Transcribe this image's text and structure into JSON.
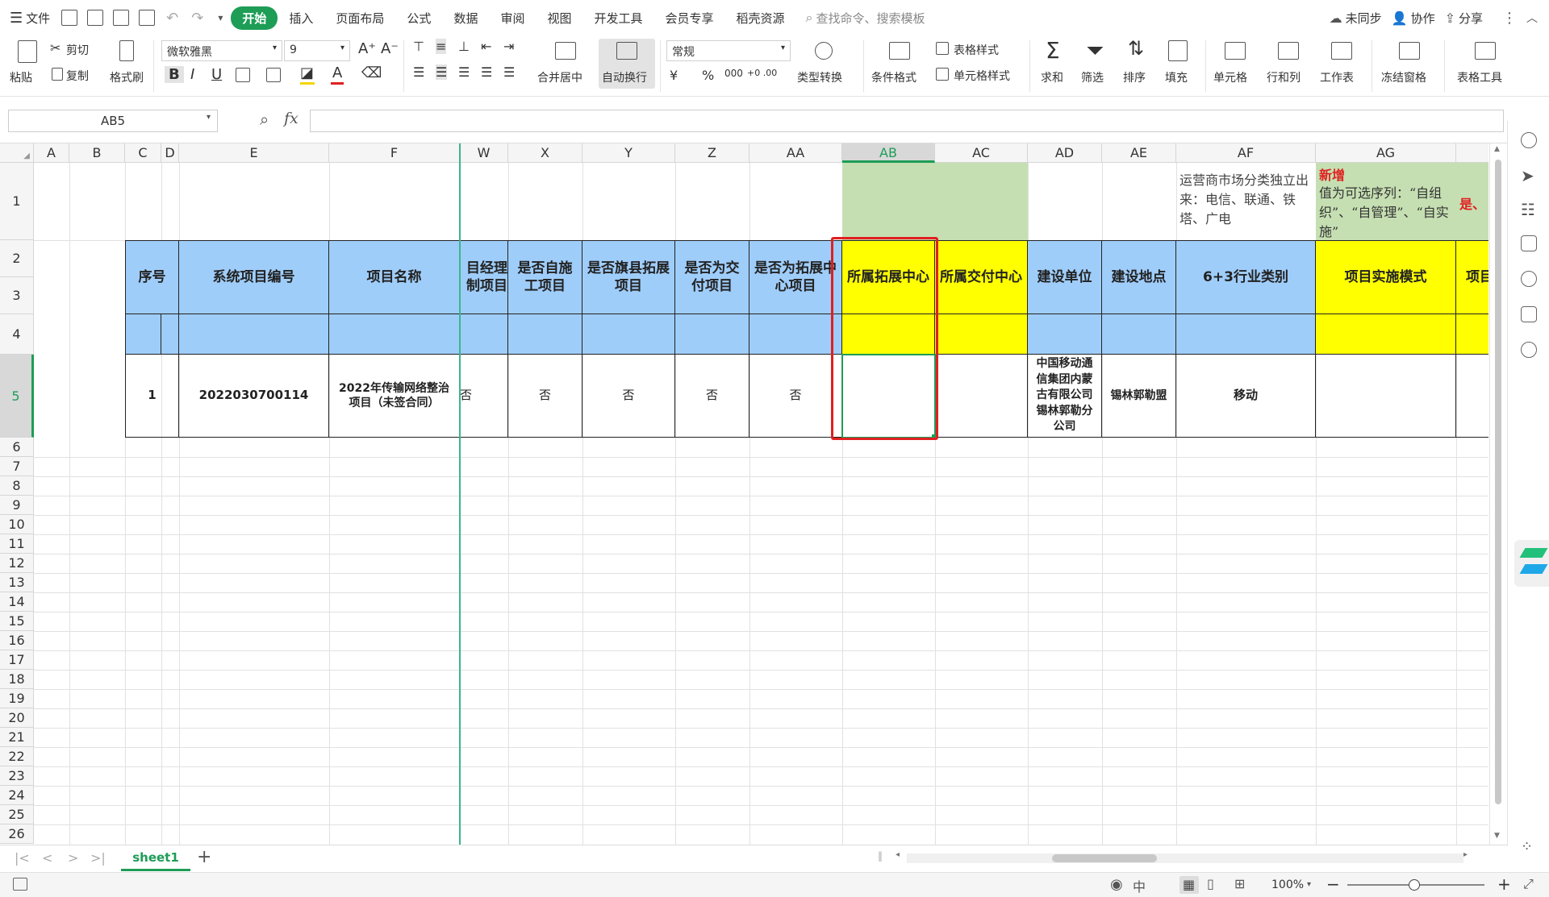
{
  "menubar": {
    "file_label": "文件",
    "tabs": [
      "开始",
      "插入",
      "页面布局",
      "公式",
      "数据",
      "审阅",
      "视图",
      "开发工具",
      "会员专享",
      "稻壳资源"
    ],
    "active_tab": "开始",
    "search_placeholder": "查找命令、搜索模板",
    "sync_label": "未同步",
    "collab_label": "协作",
    "share_label": "分享"
  },
  "ribbon": {
    "paste": "粘贴",
    "cut": "剪切",
    "copy": "复制",
    "format_painter": "格式刷",
    "font_name": "微软雅黑",
    "font_size": "9",
    "bold": "B",
    "italic": "I",
    "underline": "U",
    "font_color": "A",
    "merge_center": "合并居中",
    "wrap_text": "自动换行",
    "number_format": "常规",
    "currency": "¥",
    "percent": "%",
    "thousands": "000",
    "dec_inc": "+0 .00",
    "dec_dec": ".00 →0",
    "type_convert": "类型转换",
    "cond_format": "条件格式",
    "table_style": "表格样式",
    "cell_style": "单元格样式",
    "sum": "求和",
    "filter": "筛选",
    "sort": "排序",
    "fill": "填充",
    "cell": "单元格",
    "row_col": "行和列",
    "sheet": "工作表",
    "freeze": "冻结窗格",
    "table_tools": "表格工具"
  },
  "formula_bar": {
    "name_box": "AB5",
    "fx": "fx",
    "content": ""
  },
  "columns": [
    "A",
    "B",
    "C",
    "D",
    "E",
    "F",
    "W",
    "X",
    "Y",
    "Z",
    "AA",
    "AB",
    "AC",
    "AD",
    "AE",
    "AF",
    "AG"
  ],
  "rows": [
    "1",
    "2",
    "3",
    "4",
    "5",
    "6",
    "7",
    "8",
    "9",
    "10",
    "11",
    "12",
    "13",
    "14",
    "15",
    "16",
    "17",
    "18",
    "19",
    "20",
    "21",
    "22",
    "23",
    "24",
    "25",
    "26"
  ],
  "notes": {
    "af1": "运营商市场分类独立出来：电信、联通、铁塔、广电",
    "ag1_new": "新增",
    "ag1_text": "值为可选序列：“自组织”、“自管理”、“自实施”",
    "ah1": "是、"
  },
  "headers": {
    "seq": "序号",
    "sys_id": "系统项目编号",
    "proj_name": "项目名称",
    "w": "目经理\n制项目",
    "x": "是否自施\n工项目",
    "y": "是否旗县拓展\n项目",
    "z": "是否为交\n付项目",
    "aa": "是否为拓展中\n心项目",
    "ab": "所属拓展中心",
    "ac": "所属交付中心",
    "ad": "建设单位",
    "ae": "建设地点",
    "af": "6+3行业类别",
    "ag": "项目实施模式",
    "ah": "项目"
  },
  "row5": {
    "seq": "1",
    "sys_id": "2022030700114",
    "proj_name": "2022年传输网络整治\n项目（未签合同）",
    "w": "否",
    "x": "否",
    "y": "否",
    "z": "否",
    "aa": "否",
    "ab": "",
    "ac": "",
    "ad": "中国移动通\n信集团内蒙\n古有限公司\n锡林郭勒分\n公司",
    "ae": "锡林郭勒盟",
    "af": "移动",
    "ag": ""
  },
  "sheet_tabs": [
    "sheet1"
  ],
  "status": {
    "zoom": "100%"
  },
  "colors": {
    "accent": "#1d9d56",
    "header_blue": "#9fcdfa",
    "header_yellow": "#ffff00",
    "note_green": "#c5dfb2",
    "highlight_red": "#e02020"
  }
}
